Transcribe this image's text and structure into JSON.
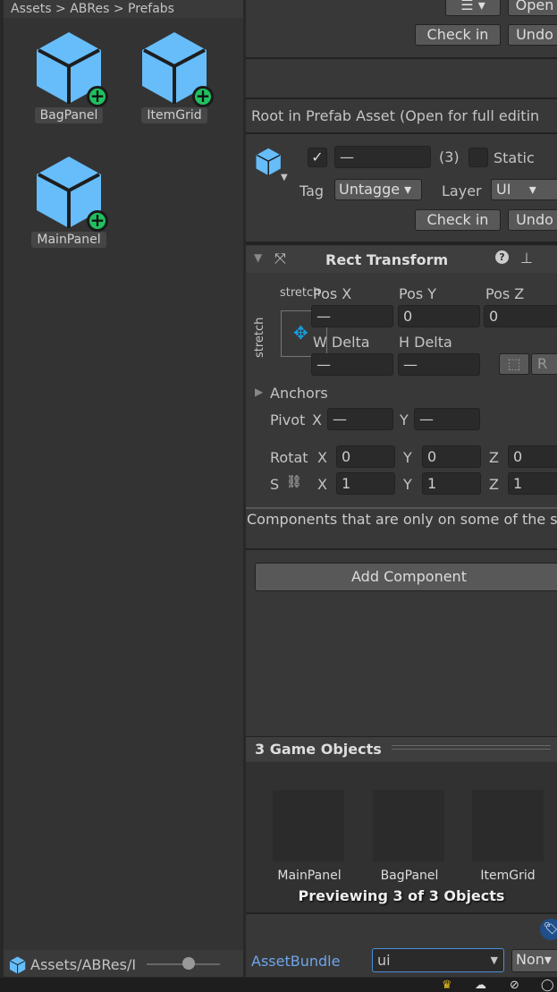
{
  "project": {
    "breadcrumb": "Assets > ABRes > Prefabs",
    "assets": [
      {
        "name": "BagPanel"
      },
      {
        "name": "ItemGrid"
      },
      {
        "name": "MainPanel"
      }
    ],
    "path": "Assets/ABRes/I",
    "zoom_slider": 0.6
  },
  "inspector": {
    "header": {
      "open_label": "Open",
      "check_in": "Check in",
      "undo": "Undo"
    },
    "prefab_notice": "Root in Prefab Asset (Open for full editin",
    "object": {
      "active": true,
      "name_value": "—",
      "count": "(3)",
      "static_label": "Static",
      "tag_label": "Tag",
      "tag_value": "Untagge",
      "layer_label": "Layer",
      "layer_value": "UI",
      "check_in": "Check in",
      "undo": "Undo"
    },
    "rect_transform": {
      "title": "Rect Transform",
      "anchor_h": "stretch",
      "anchor_v": "stretch",
      "pos_x_label": "Pos X",
      "pos_y_label": "Pos Y",
      "pos_z_label": "Pos Z",
      "pos_x": "—",
      "pos_y": "0",
      "pos_z": "0",
      "w_label": "W Delta",
      "h_label": "H Delta",
      "w": "—",
      "h": "—",
      "r_label": "R",
      "anchors": "Anchors",
      "pivot": "Pivot",
      "x": "X",
      "y": "Y",
      "z": "Z",
      "pivot_x": "—",
      "pivot_y": "—",
      "rotation": "Rotat",
      "rot_x": "0",
      "rot_y": "0",
      "rot_z": "0",
      "scale": "S",
      "scale_x": "1",
      "scale_y": "1",
      "scale_z": "1"
    },
    "multi_edit_notice": "Components that are only on some of the selected objects cannot be multi-edited.",
    "add_component": "Add Component",
    "preview": {
      "title": "3 Game Objects",
      "items": [
        "MainPanel",
        "BagPanel",
        "ItemGrid"
      ],
      "status": "Previewing 3 of 3 Objects"
    },
    "assetbundle": {
      "label": "AssetBundle",
      "value": "ui",
      "variant": "Non"
    }
  },
  "colors": {
    "accent": "#4c8ed9",
    "cube": "#66bdfa",
    "plus": "#20c060"
  }
}
